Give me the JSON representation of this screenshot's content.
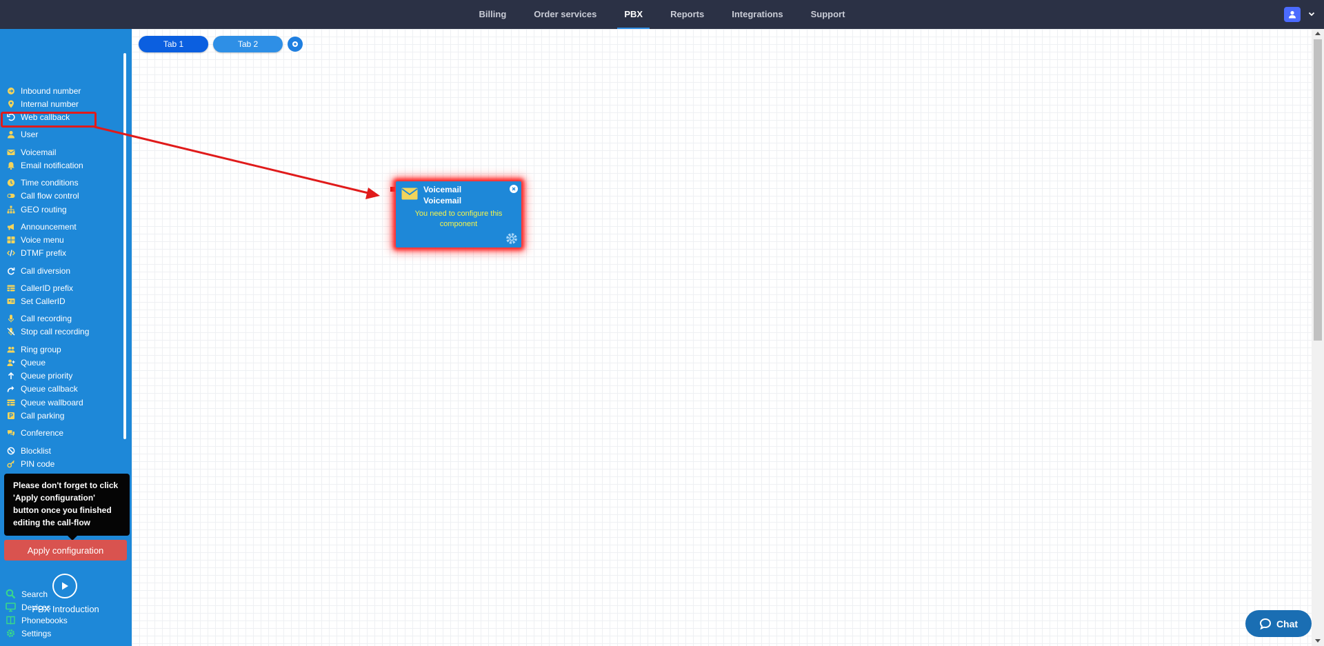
{
  "topnav": {
    "items": [
      {
        "label": "Billing",
        "active": false
      },
      {
        "label": "Order services",
        "active": false
      },
      {
        "label": "PBX",
        "active": true
      },
      {
        "label": "Reports",
        "active": false
      },
      {
        "label": "Integrations",
        "active": false
      },
      {
        "label": "Support",
        "active": false
      }
    ]
  },
  "sidebar": {
    "items": [
      {
        "label": "Inbound number",
        "icon": "arrow-circle-icon"
      },
      {
        "label": "Internal number",
        "icon": "map-pin-icon"
      },
      {
        "label": "Web callback",
        "icon": "callback-icon"
      },
      {
        "label": "User",
        "icon": "user-icon"
      },
      {
        "label": "Voicemail",
        "icon": "envelope-icon"
      },
      {
        "label": "Email notification",
        "icon": "bell-icon"
      },
      {
        "label": "Time conditions",
        "icon": "clock-icon"
      },
      {
        "label": "Call flow control",
        "icon": "toggle-icon"
      },
      {
        "label": "GEO routing",
        "icon": "sitemap-icon"
      },
      {
        "label": "Announcement",
        "icon": "megaphone-icon"
      },
      {
        "label": "Voice menu",
        "icon": "menu-grid-icon"
      },
      {
        "label": "DTMF prefix",
        "icon": "code-icon"
      },
      {
        "label": "Call diversion",
        "icon": "redo-icon"
      },
      {
        "label": "CallerID prefix",
        "icon": "table-icon"
      },
      {
        "label": "Set CallerID",
        "icon": "id-card-icon"
      },
      {
        "label": "Call recording",
        "icon": "microphone-icon"
      },
      {
        "label": "Stop call recording",
        "icon": "microphone-slash-icon"
      },
      {
        "label": "Ring group",
        "icon": "users-icon"
      },
      {
        "label": "Queue",
        "icon": "user-plus-icon"
      },
      {
        "label": "Queue priority",
        "icon": "arrow-up-icon"
      },
      {
        "label": "Queue callback",
        "icon": "share-icon"
      },
      {
        "label": "Queue wallboard",
        "icon": "table-icon"
      },
      {
        "label": "Call parking",
        "icon": "parking-icon"
      },
      {
        "label": "Conference",
        "icon": "comments-icon"
      },
      {
        "label": "Blocklist",
        "icon": "ban-icon"
      },
      {
        "label": "PIN code",
        "icon": "key-icon"
      }
    ],
    "tooltip": "Please don't forget to click 'Apply configuration' button once you finished editing the call-flow",
    "apply_label": "Apply configuration",
    "intro_label": "PBX Introduction",
    "bottom_items": [
      {
        "label": "Search",
        "icon": "search-icon"
      },
      {
        "label": "Devices",
        "icon": "monitor-icon"
      },
      {
        "label": "Phonebooks",
        "icon": "book-icon"
      },
      {
        "label": "Settings",
        "icon": "gear-icon"
      }
    ]
  },
  "tabs": [
    {
      "label": "Tab 1",
      "active": true
    },
    {
      "label": "Tab 2",
      "active": false
    }
  ],
  "component": {
    "title": "Voicemail",
    "subtitle": "Voicemail",
    "message": "You need to configure this component"
  },
  "chat": {
    "label": "Chat"
  },
  "colors": {
    "topbar": "#2b3145",
    "sidebar": "#1e88d8",
    "apply": "#d9534f",
    "highlight": "#e01b1b",
    "warning_text": "#f4f44a"
  }
}
